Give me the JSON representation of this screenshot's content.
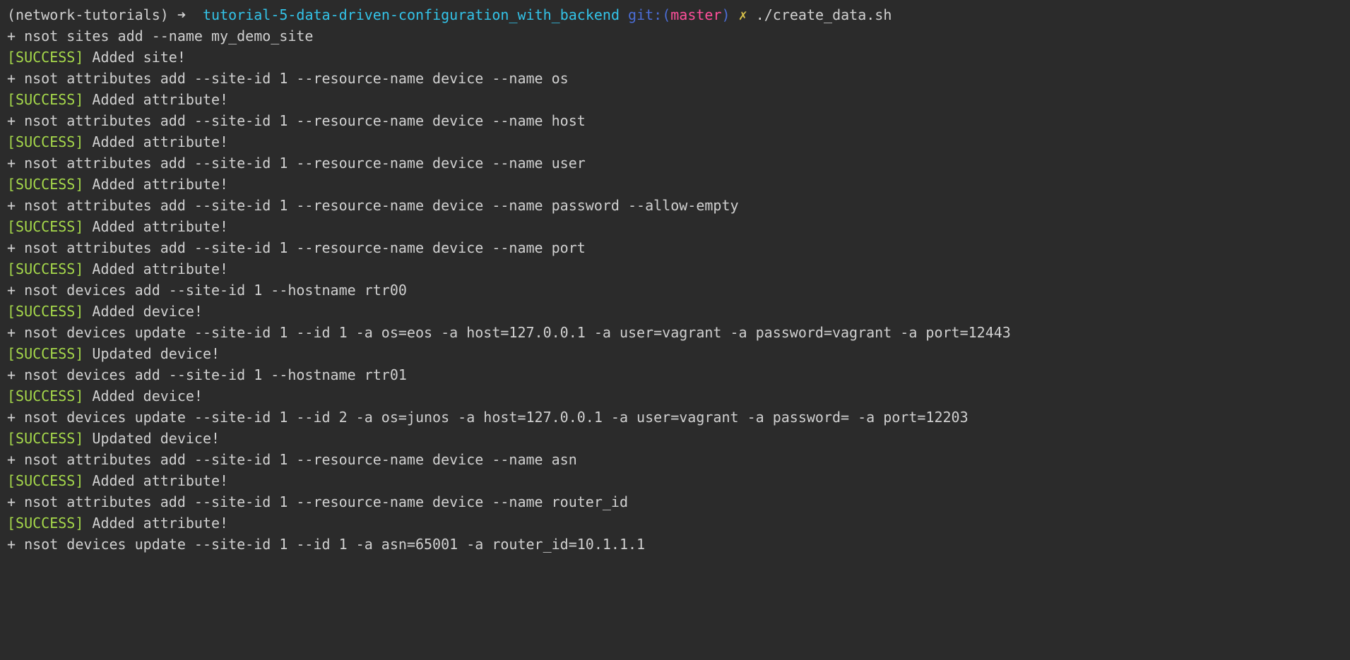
{
  "prompt": {
    "venv_open": "(",
    "venv": "network-tutorials",
    "venv_close": ")",
    "arrow": "➜",
    "dir": "tutorial-5-data-driven-configuration_with_backend",
    "git_label": "git:",
    "paren_open": "(",
    "branch": "master",
    "paren_close": ")",
    "x": "✗",
    "command": "./create_data.sh"
  },
  "lines": [
    {
      "type": "echo",
      "text": "+ nsot sites add --name my_demo_site"
    },
    {
      "type": "success",
      "tag": "[SUCCESS]",
      "msg": " Added site!"
    },
    {
      "type": "echo",
      "text": "+ nsot attributes add --site-id 1 --resource-name device --name os"
    },
    {
      "type": "success",
      "tag": "[SUCCESS]",
      "msg": " Added attribute!"
    },
    {
      "type": "echo",
      "text": "+ nsot attributes add --site-id 1 --resource-name device --name host"
    },
    {
      "type": "success",
      "tag": "[SUCCESS]",
      "msg": " Added attribute!"
    },
    {
      "type": "echo",
      "text": "+ nsot attributes add --site-id 1 --resource-name device --name user"
    },
    {
      "type": "success",
      "tag": "[SUCCESS]",
      "msg": " Added attribute!"
    },
    {
      "type": "echo",
      "text": "+ nsot attributes add --site-id 1 --resource-name device --name password --allow-empty"
    },
    {
      "type": "success",
      "tag": "[SUCCESS]",
      "msg": " Added attribute!"
    },
    {
      "type": "echo",
      "text": "+ nsot attributes add --site-id 1 --resource-name device --name port"
    },
    {
      "type": "success",
      "tag": "[SUCCESS]",
      "msg": " Added attribute!"
    },
    {
      "type": "echo",
      "text": "+ nsot devices add --site-id 1 --hostname rtr00"
    },
    {
      "type": "success",
      "tag": "[SUCCESS]",
      "msg": " Added device!"
    },
    {
      "type": "echo",
      "text": "+ nsot devices update --site-id 1 --id 1 -a os=eos -a host=127.0.0.1 -a user=vagrant -a password=vagrant -a port=12443"
    },
    {
      "type": "success",
      "tag": "[SUCCESS]",
      "msg": " Updated device!"
    },
    {
      "type": "echo",
      "text": "+ nsot devices add --site-id 1 --hostname rtr01"
    },
    {
      "type": "success",
      "tag": "[SUCCESS]",
      "msg": " Added device!"
    },
    {
      "type": "echo",
      "text": "+ nsot devices update --site-id 1 --id 2 -a os=junos -a host=127.0.0.1 -a user=vagrant -a password= -a port=12203"
    },
    {
      "type": "success",
      "tag": "[SUCCESS]",
      "msg": " Updated device!"
    },
    {
      "type": "echo",
      "text": "+ nsot attributes add --site-id 1 --resource-name device --name asn"
    },
    {
      "type": "success",
      "tag": "[SUCCESS]",
      "msg": " Added attribute!"
    },
    {
      "type": "echo",
      "text": "+ nsot attributes add --site-id 1 --resource-name device --name router_id"
    },
    {
      "type": "success",
      "tag": "[SUCCESS]",
      "msg": " Added attribute!"
    },
    {
      "type": "echo",
      "text": "+ nsot devices update --site-id 1 --id 1 -a asn=65001 -a router_id=10.1.1.1"
    }
  ]
}
